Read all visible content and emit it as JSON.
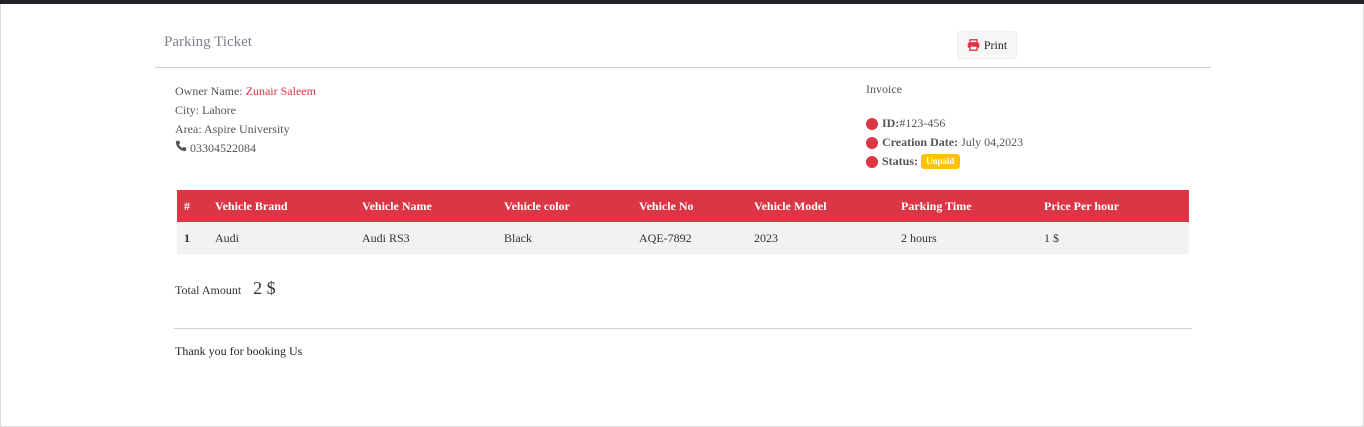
{
  "header": {
    "title": "Parking Ticket",
    "print_label": "Print"
  },
  "owner": {
    "name_label": "Owner Name: ",
    "name_value": "Zunair Saleem",
    "city": "City: Lahore",
    "area": "Area: Aspire University",
    "phone": "03304522084"
  },
  "invoice": {
    "title": "Invoice",
    "id_label": "ID:",
    "id_value": "#123-456",
    "date_label": "Creation Date:",
    "date_value": " July 04,2023",
    "status_label": "Status:",
    "status_value": "Unpaid"
  },
  "table": {
    "headers": [
      "#",
      "Vehicle Brand",
      "Vehicle Name",
      "Vehicle color",
      "Vehicle No",
      "Vehicle Model",
      "Parking Time",
      "Price Per hour"
    ],
    "rows": [
      [
        "1",
        "Audi",
        "Audi RS3",
        "Black",
        "AQE-7892",
        "2023",
        "2 hours",
        "1 $"
      ]
    ]
  },
  "total": {
    "label": "Total Amount",
    "value": "2 $"
  },
  "footer": {
    "thanks": "Thank you for booking Us"
  },
  "colors": {
    "accent": "#dc3545",
    "badge": "#ffc107",
    "topbar": "#212529"
  },
  "icons": {
    "print": "print-icon",
    "phone": "phone-icon",
    "bullet": "circle-dot-icon"
  }
}
